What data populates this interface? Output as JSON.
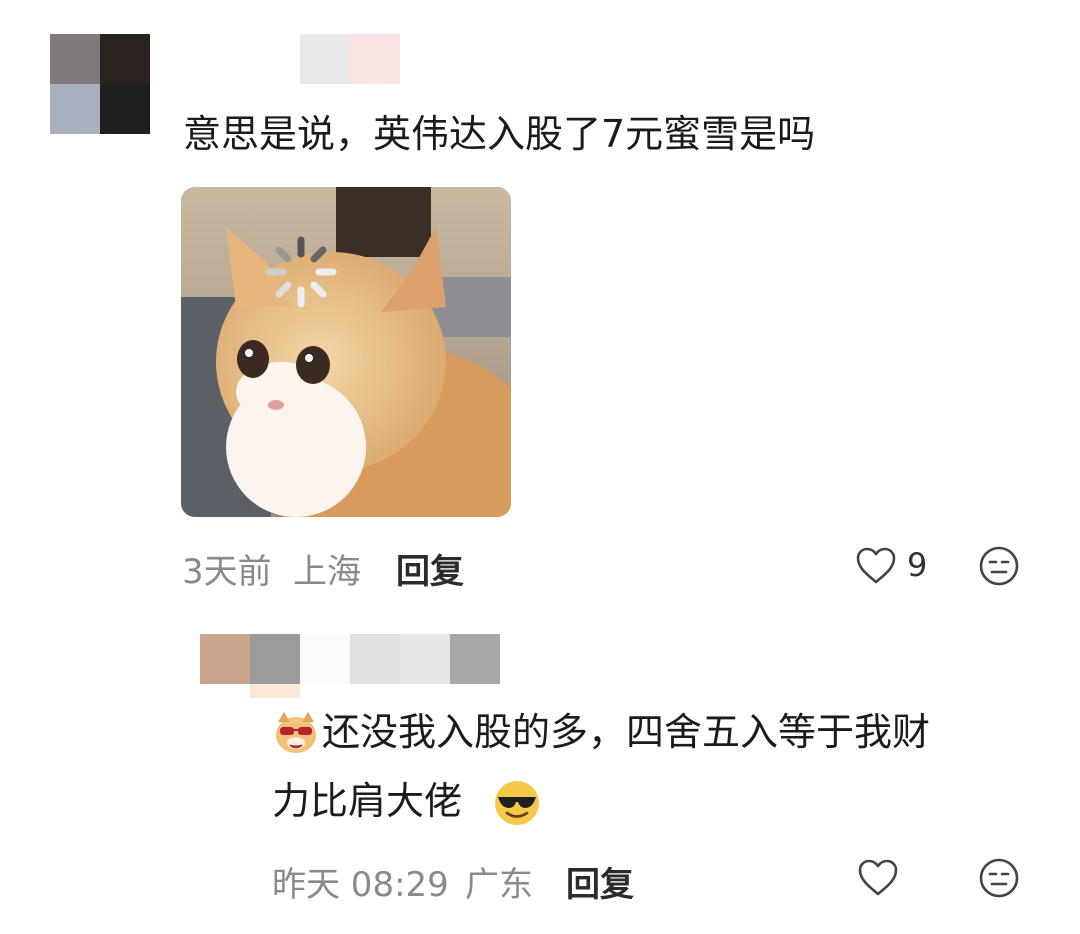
{
  "comment1": {
    "text": "意思是说，英伟达入股了7元蜜雪是吗",
    "time": "3天前",
    "location": "上海",
    "reply_label": "回复",
    "like_count": "9",
    "like_icon": "heart-outline",
    "dislike_icon": "neutral-face"
  },
  "reply1": {
    "text_line1": "还没我入股的多，四舍五入等于我财",
    "text_line2": "力比肩大佬",
    "emoji_prefix": "dog-sunglasses-sticker",
    "emoji_suffix": "sunglasses-face",
    "time": "昨天 08:29",
    "location": "广东",
    "reply_label": "回复",
    "like_icon": "heart-outline",
    "dislike_icon": "neutral-face"
  },
  "colors": {
    "text": "#1b1b1b",
    "meta": "#8a8a8a",
    "icon": "#555555"
  }
}
